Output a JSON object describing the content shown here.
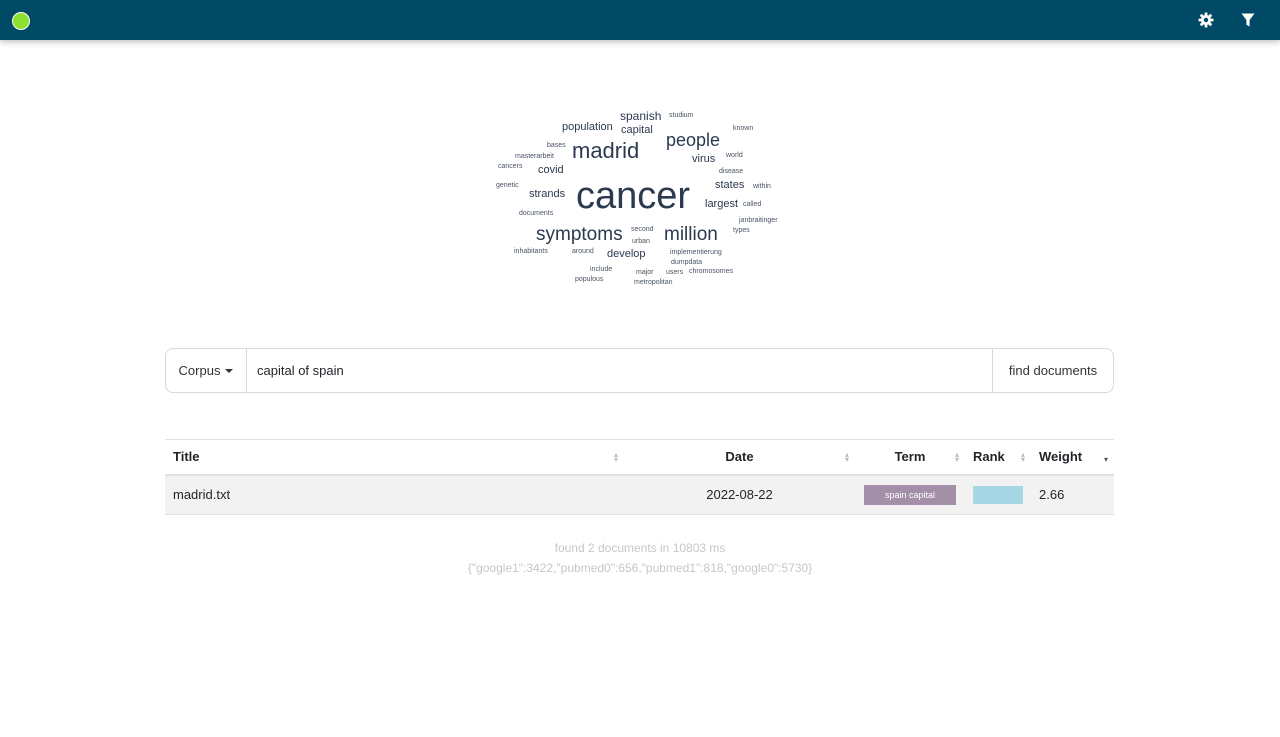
{
  "navbar": {
    "background": "#004a66",
    "status_color": "#8ee02f",
    "icons": [
      "gear-icon",
      "filter-icon"
    ]
  },
  "word_cloud": {
    "words": [
      {
        "text": "cancer",
        "size": 38
      },
      {
        "text": "madrid",
        "size": 22
      },
      {
        "text": "symptoms",
        "size": 19
      },
      {
        "text": "million",
        "size": 19
      },
      {
        "text": "people",
        "size": 18
      },
      {
        "text": "spanish",
        "size": 12
      },
      {
        "text": "population",
        "size": 11
      },
      {
        "text": "capital",
        "size": 11
      },
      {
        "text": "virus",
        "size": 11
      },
      {
        "text": "covid",
        "size": 11
      },
      {
        "text": "strands",
        "size": 11
      },
      {
        "text": "states",
        "size": 11
      },
      {
        "text": "largest",
        "size": 11
      },
      {
        "text": "develop",
        "size": 11
      },
      {
        "text": "studium",
        "size": 7
      },
      {
        "text": "known",
        "size": 7
      },
      {
        "text": "bases",
        "size": 7
      },
      {
        "text": "masterarbeit",
        "size": 7
      },
      {
        "text": "world",
        "size": 7
      },
      {
        "text": "cancers",
        "size": 7
      },
      {
        "text": "disease",
        "size": 7
      },
      {
        "text": "genetic",
        "size": 7
      },
      {
        "text": "within",
        "size": 7
      },
      {
        "text": "called",
        "size": 7
      },
      {
        "text": "documents",
        "size": 7
      },
      {
        "text": "janbraitinger",
        "size": 7
      },
      {
        "text": "second",
        "size": 7
      },
      {
        "text": "types",
        "size": 7
      },
      {
        "text": "urban",
        "size": 7
      },
      {
        "text": "inhabitants",
        "size": 7
      },
      {
        "text": "around",
        "size": 7
      },
      {
        "text": "implementierung",
        "size": 7
      },
      {
        "text": "dumpdata",
        "size": 7
      },
      {
        "text": "include",
        "size": 7
      },
      {
        "text": "major",
        "size": 7
      },
      {
        "text": "users",
        "size": 7
      },
      {
        "text": "chromosomes",
        "size": 7
      },
      {
        "text": "populous",
        "size": 7
      },
      {
        "text": "metropolitan",
        "size": 7
      }
    ]
  },
  "search": {
    "corpus_label": "Corpus",
    "query": "capital of spain",
    "find_label": "find documents"
  },
  "table": {
    "headers": {
      "title": "Title",
      "date": "Date",
      "term": "Term",
      "rank": "Rank",
      "weight": "Weight"
    },
    "rows": [
      {
        "title": "madrid.txt",
        "date": "2022-08-22",
        "term": "spain capital",
        "rank_fill": 1.0,
        "weight": "2.66"
      }
    ]
  },
  "footer": {
    "summary": "found 2 documents in 10803 ms",
    "stats": "{\"google1\":3422,\"pubmed0\":656,\"pubmed1\":818,\"google0\":5730}"
  }
}
